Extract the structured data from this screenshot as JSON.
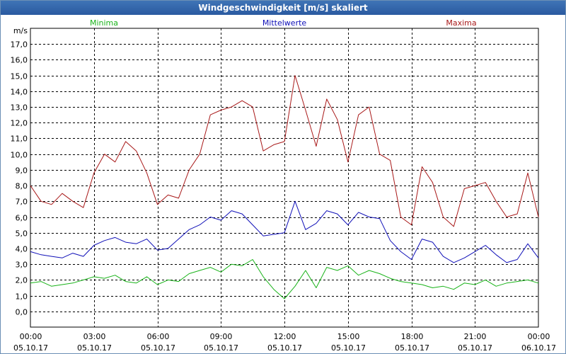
{
  "window": {
    "title": "Windgeschwindigkeit [m/s] skaliert"
  },
  "colors": {
    "minima": "#19b319",
    "mittel": "#1010b8",
    "maxima": "#a81818",
    "grid": "#000000"
  },
  "chart_data": {
    "type": "line",
    "title": "Windgeschwindigkeit [m/s] skaliert",
    "ylabel": "m/s",
    "xlabel": "",
    "ylim": [
      -1,
      18
    ],
    "xlim": [
      0,
      24
    ],
    "grid": true,
    "legend_position": "top",
    "y_ticks": [
      "0,0",
      "1,0",
      "2,0",
      "3,0",
      "4,0",
      "5,0",
      "6,0",
      "7,0",
      "8,0",
      "9,0",
      "10,0",
      "11,0",
      "12,0",
      "13,0",
      "14,0",
      "15,0",
      "16,0",
      "17,0"
    ],
    "x_ticks": [
      {
        "time": "00:00",
        "date": "05.10.17"
      },
      {
        "time": "03:00",
        "date": "05.10.17"
      },
      {
        "time": "06:00",
        "date": "05.10.17"
      },
      {
        "time": "09:00",
        "date": "05.10.17"
      },
      {
        "time": "12:00",
        "date": "05.10.17"
      },
      {
        "time": "15:00",
        "date": "05.10.17"
      },
      {
        "time": "18:00",
        "date": "05.10.17"
      },
      {
        "time": "21:00",
        "date": "05.10.17"
      },
      {
        "time": "00:00",
        "date": "06.10.17"
      }
    ],
    "x_hours": [
      0,
      0.5,
      1,
      1.5,
      2,
      2.5,
      3,
      3.5,
      4,
      4.5,
      5,
      5.5,
      6,
      6.5,
      7,
      7.5,
      8,
      8.5,
      9,
      9.5,
      10,
      10.5,
      11,
      11.5,
      12,
      12.5,
      13,
      13.5,
      14,
      14.5,
      15,
      15.5,
      16,
      16.5,
      17,
      17.5,
      18,
      18.5,
      19,
      19.5,
      20,
      20.5,
      21,
      21.5,
      22,
      22.5,
      23,
      23.5,
      24
    ],
    "series": [
      {
        "name": "Minima",
        "color": "#19b319",
        "values": [
          1.8,
          1.9,
          1.6,
          1.7,
          1.8,
          2.0,
          2.2,
          2.1,
          2.3,
          1.9,
          1.8,
          2.2,
          1.7,
          2.0,
          1.9,
          2.4,
          2.6,
          2.8,
          2.5,
          3.0,
          2.9,
          3.3,
          2.2,
          1.4,
          0.8,
          1.6,
          2.6,
          1.5,
          2.8,
          2.6,
          2.9,
          2.3,
          2.6,
          2.4,
          2.1,
          1.9,
          1.8,
          1.7,
          1.5,
          1.6,
          1.4,
          1.8,
          1.7,
          2.0,
          1.6,
          1.8,
          1.9,
          2.0,
          1.8
        ]
      },
      {
        "name": "Mittelwerte",
        "color": "#1010b8",
        "values": [
          3.8,
          3.6,
          3.5,
          3.4,
          3.7,
          3.5,
          4.2,
          4.5,
          4.7,
          4.4,
          4.3,
          4.6,
          3.9,
          4.0,
          4.6,
          5.2,
          5.5,
          6.0,
          5.8,
          6.4,
          6.2,
          5.5,
          4.8,
          4.9,
          5.0,
          7.0,
          5.2,
          5.6,
          6.4,
          6.2,
          5.5,
          6.3,
          6.0,
          5.9,
          4.5,
          3.8,
          3.3,
          4.6,
          4.4,
          3.5,
          3.1,
          3.4,
          3.8,
          4.2,
          3.6,
          3.1,
          3.3,
          4.3,
          3.4
        ]
      },
      {
        "name": "Maxima",
        "color": "#a81818",
        "values": [
          8.0,
          7.0,
          6.8,
          7.5,
          7.0,
          6.6,
          8.8,
          10.0,
          9.5,
          10.8,
          10.2,
          8.8,
          6.8,
          7.4,
          7.2,
          9.0,
          10.0,
          12.5,
          12.8,
          13.0,
          13.4,
          13.0,
          10.2,
          10.6,
          10.8,
          15.0,
          12.8,
          10.5,
          13.5,
          12.2,
          9.5,
          12.5,
          13.0,
          10.0,
          9.6,
          6.0,
          5.5,
          9.2,
          8.2,
          6.0,
          5.4,
          7.8,
          8.0,
          8.2,
          7.0,
          6.0,
          6.2,
          8.8,
          6.0
        ]
      }
    ]
  }
}
